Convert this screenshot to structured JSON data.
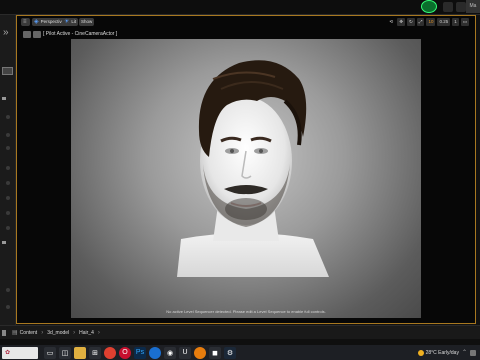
{
  "topbar": {
    "right_label": "Ma",
    "status_color": "#33ff77"
  },
  "left_panel": {
    "collapse_icon": "chevron-double-right-icon"
  },
  "viewport": {
    "border_color": "#a87820",
    "view_mode_label": "Perspective",
    "lit_label": "Lit",
    "show_label": "Show",
    "snap_value": "10",
    "scale_value": "0.25",
    "camera_speed": "1",
    "pilot_label": "[ Pilot Active - CineCameraActor ]"
  },
  "scene": {
    "notice": "No active Level Sequencer detected. Please edit a Level Sequence to enable full controls."
  },
  "content_browser": {
    "breadcrumb": [
      "Content",
      "3d_model",
      "Hair_4"
    ]
  },
  "taskbar": {
    "weather": "28°C  Early/day",
    "apps": [
      "file-explorer-icon",
      "store-icon",
      "chrome-icon",
      "opera-icon",
      "photoshop-icon",
      "edge-icon",
      "obs-icon",
      "unreal-icon",
      "blender-icon",
      "app-icon",
      "steam-icon"
    ]
  }
}
